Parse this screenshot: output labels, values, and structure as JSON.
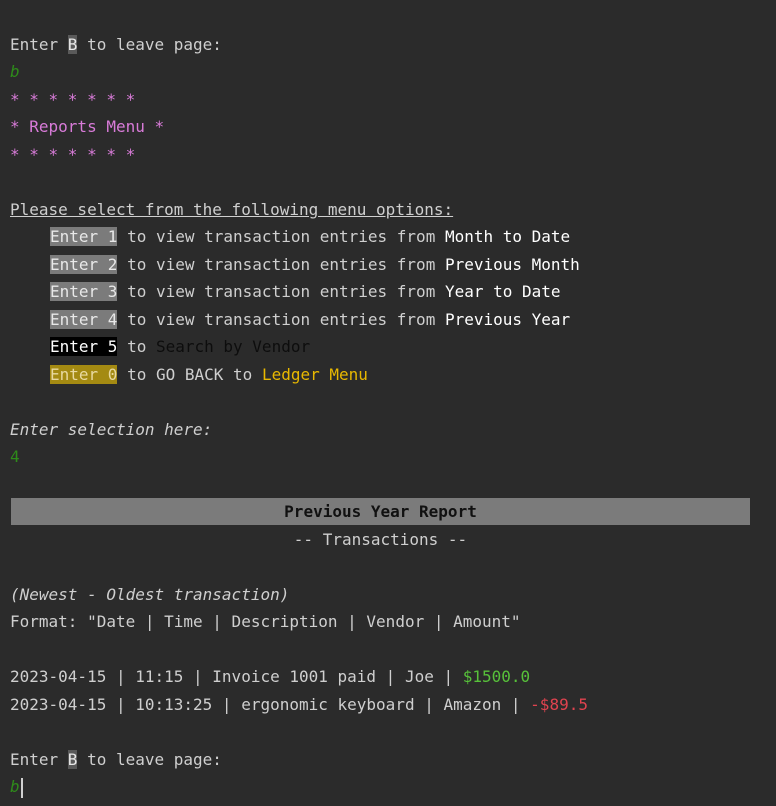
{
  "prompt1": {
    "pre": "Enter ",
    "key": "B",
    "post": " to leave page:",
    "input": "b"
  },
  "stars_top": "* * * * * * *",
  "menu_title": "* Reports Menu *",
  "stars_bottom": "* * * * * * *",
  "instruction": "Please select from the following menu options:",
  "options": [
    {
      "key": "Enter 1",
      "mid": " to view transaction entries from ",
      "target": "Month to Date"
    },
    {
      "key": "Enter 2",
      "mid": " to view transaction entries from ",
      "target": "Previous Month"
    },
    {
      "key": "Enter 3",
      "mid": " to view transaction entries from ",
      "target": "Year to Date"
    },
    {
      "key": "Enter 4",
      "mid": " to view transaction entries from ",
      "target": "Previous Year"
    },
    {
      "key": "Enter 5",
      "mid": " to ",
      "target": "Search by Vendor"
    },
    {
      "key": "Enter 0",
      "mid": " to GO BACK to ",
      "target": "Ledger Menu"
    }
  ],
  "selection_prompt": "Enter selection here:",
  "selection_input": "4",
  "report_title": "Previous Year Report",
  "report_subtitle": "-- Transactions --",
  "order_note": "(Newest - Oldest transaction)",
  "format_line": "Format: \"Date | Time | Description | Vendor | Amount\"",
  "transactions": [
    {
      "prefix": "2023-04-15 | 11:15 | Invoice 1001 paid | Joe | ",
      "amount": "$1500.0"
    },
    {
      "prefix": "2023-04-15 | 10:13:25 | ergonomic keyboard | Amazon | ",
      "amount": "-$89.5"
    }
  ],
  "prompt2": {
    "pre": "Enter ",
    "key": "B",
    "post": " to leave page:",
    "input": "b"
  },
  "colors": {
    "background": "#2b2b2b",
    "pink": "#d87bd8",
    "green_input": "#2e8b1a",
    "positive": "#57c13a",
    "negative": "#e0434f",
    "gold": "#e8b800"
  }
}
